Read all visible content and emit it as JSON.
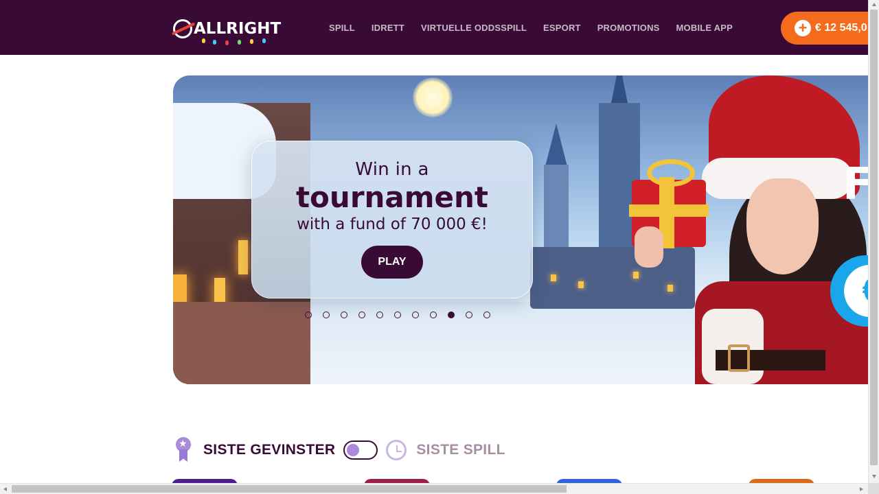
{
  "header": {
    "logo_text": "ALLRIGHT",
    "nav": [
      "SPILL",
      "IDRETT",
      "VIRTUELLE ODDSSPILL",
      "ESPORT",
      "PROMOTIONS",
      "MOBILE APP"
    ],
    "balance": "€ 12 545,0"
  },
  "hero": {
    "line1": "Win in a",
    "line2": "tournament",
    "line3": "with a fund of 70 000 €!",
    "play_label": "PLAY",
    "side_text": "F",
    "coin_symbol": "€",
    "slide_count": 11,
    "active_slide": 9
  },
  "winners": {
    "title": "SISTE GEVINSTER",
    "alt_title": "SISTE SPILL"
  },
  "colors": {
    "brand": "#3a0a36",
    "accent": "#f46b1b",
    "toggle_knob": "#a98bd9"
  }
}
